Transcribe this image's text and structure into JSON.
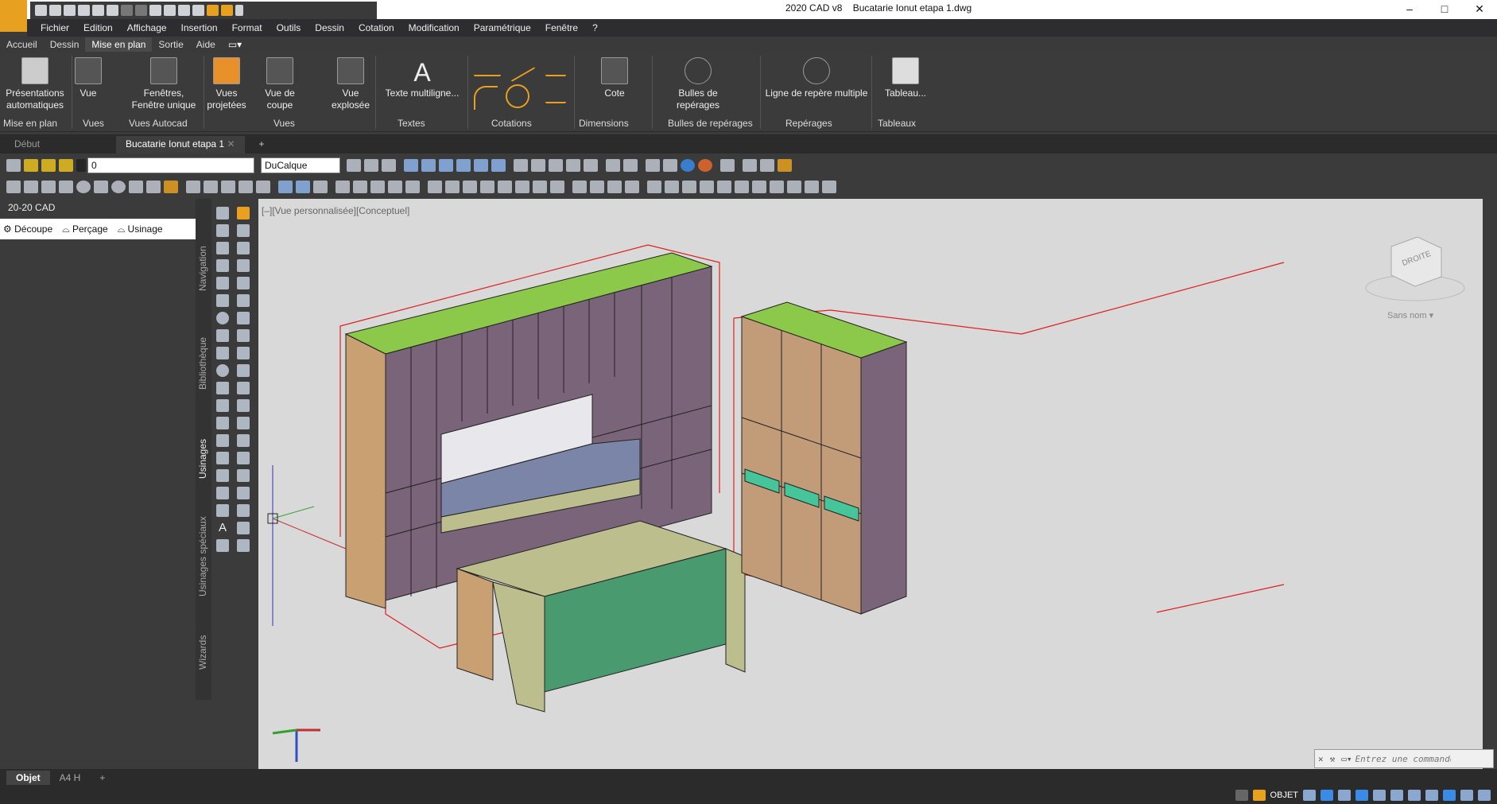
{
  "app": {
    "name": "2020 CAD v8",
    "document": "Bucatarie Ionut etapa 1.dwg"
  },
  "window_controls": [
    "–",
    "□",
    "✕"
  ],
  "menu": [
    "Fichier",
    "Edition",
    "Affichage",
    "Insertion",
    "Format",
    "Outils",
    "Dessin",
    "Cotation",
    "Modification",
    "Paramétrique",
    "Fenêtre",
    "?"
  ],
  "ribbon_tabs": [
    "Accueil",
    "Dessin",
    "Mise en plan",
    "Sortie",
    "Aide"
  ],
  "active_ribbon_tab": "Mise en plan",
  "ribbon": {
    "buttons": [
      {
        "label": "Présentations automatiques",
        "icon": "layout-icon"
      },
      {
        "label": "Vue",
        "icon": "view-icon"
      },
      {
        "label": "Fenêtres, Fenêtre unique",
        "icon": "viewports-icon"
      },
      {
        "label": "Vues projetées",
        "icon": "projected-views-icon"
      },
      {
        "label": "Vue de coupe",
        "icon": "section-view-icon"
      },
      {
        "label": "Vue explosée",
        "icon": "exploded-view-icon"
      },
      {
        "label": "Texte multiligne...",
        "icon": "text-icon"
      },
      {
        "label": "Cote",
        "icon": "dimension-icon"
      },
      {
        "label": "Bulles de repérages",
        "icon": "balloon-icon"
      },
      {
        "label": "Ligne de repère multiple",
        "icon": "multileader-icon"
      },
      {
        "label": "Tableau...",
        "icon": "table-icon"
      }
    ],
    "panels": [
      "Mise en plan",
      "Vues",
      "Vues Autocad",
      "Vues",
      "Textes",
      "Cotations",
      "Dimensions",
      "Bulles de repérages",
      "Repérages",
      "Tableaux"
    ]
  },
  "doc_tabs": [
    "Début",
    "Bucatarie Ionut etapa 1"
  ],
  "toolbar": {
    "layer_value": "0",
    "linetype_value": "DuCalque"
  },
  "left_panel": {
    "title": "20-20 CAD",
    "tabs": [
      "Découpe",
      "Perçage",
      "Usinage"
    ]
  },
  "side_tabs": [
    "Navigation",
    "Bibliothèque",
    "Usinages",
    "Usinages spéciaux",
    "Wizards"
  ],
  "viewport": {
    "label": "[–][Vue personnalisée][Conceptuel]",
    "viewcube_label": "DROITE",
    "ucs_label": "Sans nom"
  },
  "command_placeholder": "Entrez une commande",
  "layout_tabs": [
    "Objet",
    "A4 H"
  ],
  "status": {
    "mode": "OBJET"
  },
  "colors": {
    "ribbon_bg": "#3b3b3b",
    "viewport_bg": "#d9d9d9",
    "cabinet_body": "#7a6479",
    "cabinet_side": "#c8a071",
    "countertop": "#8cc84a",
    "island": "#4a9a6f"
  }
}
